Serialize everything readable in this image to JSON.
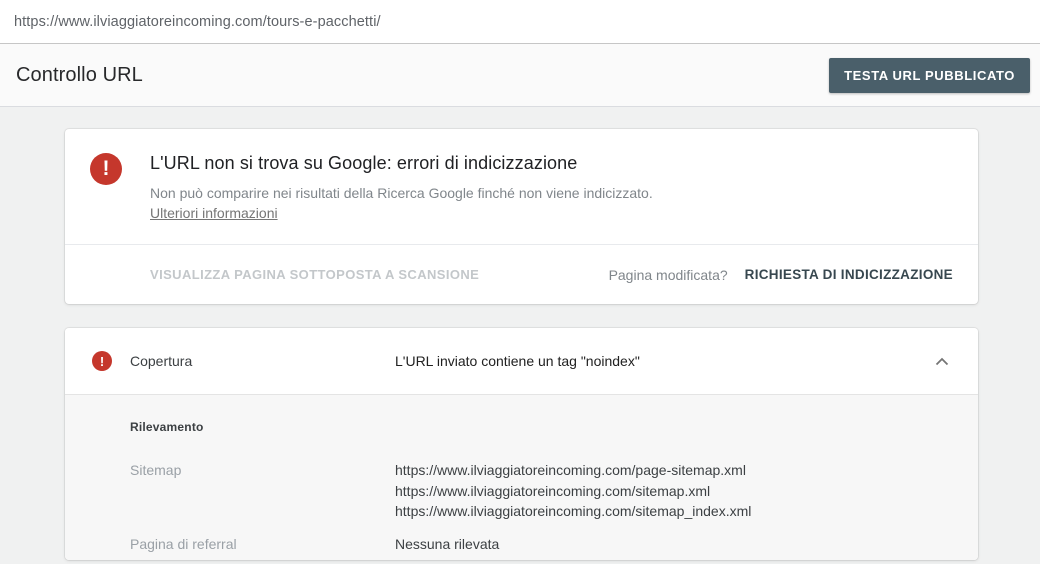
{
  "url_bar": {
    "url": "https://www.ilviaggiatoreincoming.com/tours-e-pacchetti/"
  },
  "header": {
    "title": "Controllo URL",
    "test_button_label": "TESTA URL PUBBLICATO"
  },
  "status_card": {
    "title": "L'URL non si trova su Google: errori di indicizzazione",
    "description": "Non può comparire nei risultati della Ricerca Google finché non viene indicizzato.",
    "link_label": "Ulteriori informazioni",
    "view_crawled_button_label": "VISUALIZZA PAGINA SOTTOPOSTA A SCANSIONE",
    "page_changed_label": "Pagina modificata?",
    "request_indexing_button_label": "RICHIESTA DI INDICIZZAZIONE"
  },
  "coverage_card": {
    "title": "Copertura",
    "status": "L'URL inviato contiene un tag \"noindex\"",
    "section_title": "Rilevamento",
    "sitemap_row": {
      "label": "Sitemap",
      "values": [
        "https://www.ilviaggiatoreincoming.com/page-sitemap.xml",
        "https://www.ilviaggiatoreincoming.com/sitemap.xml",
        "https://www.ilviaggiatoreincoming.com/sitemap_index.xml"
      ]
    },
    "referral_row": {
      "label": "Pagina di referral",
      "value": "Nessuna rilevata"
    }
  },
  "icons": {
    "error_icon_glyph": "!",
    "chevron_up_icon": "chevron-up"
  },
  "colors": {
    "error_red": "#c5372c",
    "button_slate": "#4a5f6a",
    "action_dark_slate": "#37474f",
    "disabled_gray": "#c3c7ca",
    "label_gray": "#9aa0a6"
  }
}
